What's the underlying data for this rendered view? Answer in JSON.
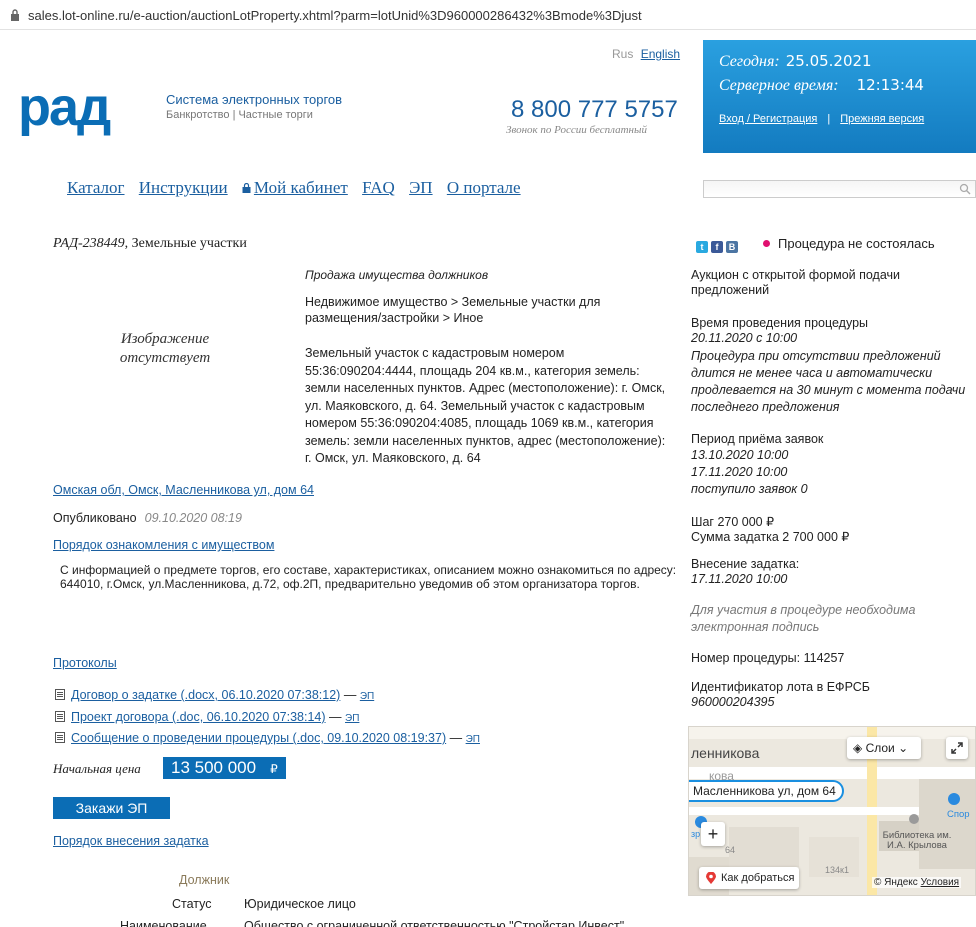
{
  "browser": {
    "url": "sales.lot-online.ru/e-auction/auctionLotProperty.xhtml?parm=lotUnid%3D960000286432%3Bmode%3Djust"
  },
  "header": {
    "logo": "рад",
    "tagline": "Система электронных торгов",
    "tagline_sub": "Банкротство | Частные торги",
    "lang_ru": "Rus",
    "lang_en": "English",
    "phone": "8 800 777 5757",
    "phone_sub": "Звонок по России бесплатный",
    "today_label": "Сегодня:",
    "today_value": "25.05.2021",
    "server_time_label": "Серверное время:",
    "server_time_value": "12:13:44",
    "login_link": "Вход / Регистрация",
    "separator": "|",
    "old_version_link": "Прежняя версия"
  },
  "nav": {
    "items": [
      "Каталог",
      "Инструкции",
      "Мой кабинет",
      "FAQ",
      "ЭП",
      "О портале"
    ]
  },
  "lot": {
    "code": "РАД-238449",
    "title_rest": ", Земельные участки",
    "status": "Процедура не состоялась",
    "no_image": "Изображение отсутствует",
    "category": "Продажа имущества должников",
    "path": "Недвижимое имущество > Земельные участки для размещения/застройки > Иное",
    "description": "Земельный участок с кадастровым номером 55:36:090204:4444, площадь 204 кв.м., категория земель: земли населенных пунктов. Адрес (местоположение): г. Омск, ул. Маяковского, д. 64. Земельный участок с кадастровым номером 55:36:090204:4085, площадь 1069 кв.м., категория земель: земли населенных пунктов, адрес (местоположение): г. Омск, ул. Маяковского, д. 64",
    "address": "Омская обл, Омск, Масленникова ул, дом 64",
    "published_label": "Опубликовано",
    "published_date": "09.10.2020 08:19",
    "view_order_link": "Порядок ознакомления с имуществом",
    "view_order_text": "С информацией о предмете торгов, его составе, характеристиках, описанием можно ознакомиться по адресу: 644010, г.Омск, ул.Масленникова, д.72, оф.2П, предварительно уведомив об этом организатора торгов.",
    "protocols_link": "Протоколы",
    "documents": [
      {
        "name": "Договор о задатке (.docx, 06.10.2020 07:38:12)",
        "dash": "—",
        "ep": "ЭП"
      },
      {
        "name": "Проект договора (.doc, 06.10.2020 07:38:14)",
        "dash": "—",
        "ep": "ЭП"
      },
      {
        "name": "Сообщение о проведении процедуры (.doc, 09.10.2020 08:19:37)",
        "dash": "—",
        "ep": "ЭП"
      }
    ],
    "start_price_label": "Начальная цена",
    "start_price": "13 500 000",
    "currency": "₽",
    "order_ep_button": "Закажи ЭП",
    "deposit_order_link": "Порядок внесения задатка",
    "debtor_title": "Должник",
    "debtor_status_label": "Статус",
    "debtor_status": "Юридическое лицо",
    "debtor_name_label": "Наименование",
    "debtor_name": "Общество с ограниченной ответственностью \"Стройстар Инвест\""
  },
  "sidebar": {
    "auction_type": "Аукцион с открытой формой подачи предложений",
    "time_label": "Время проведения процедуры",
    "time_value": "20.11.2020 с 10:00",
    "time_note": "Процедура при отсутствии предложений длится не менее часа и автоматически продлевается на 30 минут с момента подачи последнего предложения",
    "period_label": "Период приёма заявок",
    "period_from": "13.10.2020 10:00",
    "period_to": "17.11.2020 10:00",
    "applications": "поступило заявок 0",
    "step": "Шаг  270 000 ₽",
    "deposit_sum": "Сумма задатка  2 700 000 ₽",
    "deposit_date_label": "Внесение задатка:",
    "deposit_date": "17.11.2020 10:00",
    "ep_note": "Для участия в процедуре необходима электронная подпись",
    "procedure_number": "Номер процедуры: 114257",
    "efrsb_label": "Идентификатор лота в ЕФРСБ",
    "efrsb_value": "960000204395"
  },
  "map": {
    "street_label": "ленникова",
    "street_label2": "кова",
    "layers_button": "Слои",
    "pin_label": "Масленникова ул, дом 64",
    "sport_label": "Спор",
    "library_label": "Библиотека им. И.А. Крылова",
    "num_64": "64",
    "num_134": "134к1",
    "left_label": "зр  айн",
    "route_button": "Как добраться",
    "copyright": "© Яндекс",
    "terms": "Условия"
  },
  "colors": {
    "brand": "#0b6db5",
    "link": "#1b5fa0",
    "status_dot": "#e0106f",
    "header_box": "#1a8ad0"
  },
  "social_icons": [
    "twitter-icon",
    "facebook-icon",
    "vk-icon"
  ]
}
